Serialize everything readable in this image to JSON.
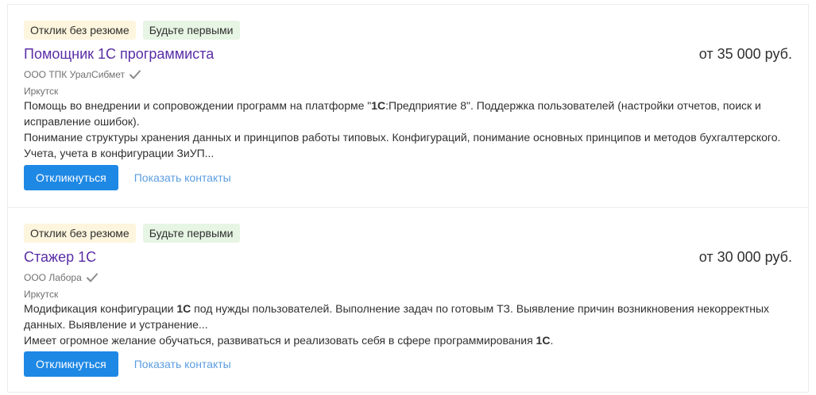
{
  "vacancies": [
    {
      "badges": [
        "Отклик без резюме",
        "Будьте первыми"
      ],
      "title": "Помощник 1С программиста",
      "salary": "от 35 000 руб.",
      "company": "ООО ТПК УралСибмет",
      "city": "Иркутск",
      "desc_p1_pre": "Помощь во внедрении и сопровождении программ на платформе \"",
      "desc_p1_bold": "1С",
      "desc_p1_post": ":Предприятие 8\". Поддержка пользователей (настройки отчетов, поиск и исправление ошибок).",
      "desc_p2": "Понимание структуры хранения данных и принципов работы типовых. Конфигураций, понимание основных принципов и методов бухгалтерского. Учета, учета в конфигурации ЗиУП...",
      "respond_label": "Откликнуться",
      "contacts_label": "Показать контакты"
    },
    {
      "badges": [
        "Отклик без резюме",
        "Будьте первыми"
      ],
      "title": "Стажер 1С",
      "salary": "от 30 000 руб.",
      "company": "ООО Лабора",
      "city": "Иркутск",
      "desc_p1_pre": "Модификация конфигурации ",
      "desc_p1_bold": "1С",
      "desc_p1_post": " под нужды пользователей. Выполнение задач по готовым ТЗ. Выявление причин возникновения некорректных данных. Выявление и устранение...",
      "desc_p2_pre": "Имеет огромное желание обучаться, развиваться и реализовать себя в сфере программирования ",
      "desc_p2_bold": "1С",
      "desc_p2_post": ".",
      "respond_label": "Откликнуться",
      "contacts_label": "Показать контакты"
    }
  ],
  "icons": {
    "verified": "check-icon"
  },
  "colors": {
    "title": "#5a2ea6",
    "button": "#1e88e5",
    "link": "#5b9de0",
    "badge_warm": "#fdf5dd",
    "badge_green": "#e7f5e4"
  }
}
